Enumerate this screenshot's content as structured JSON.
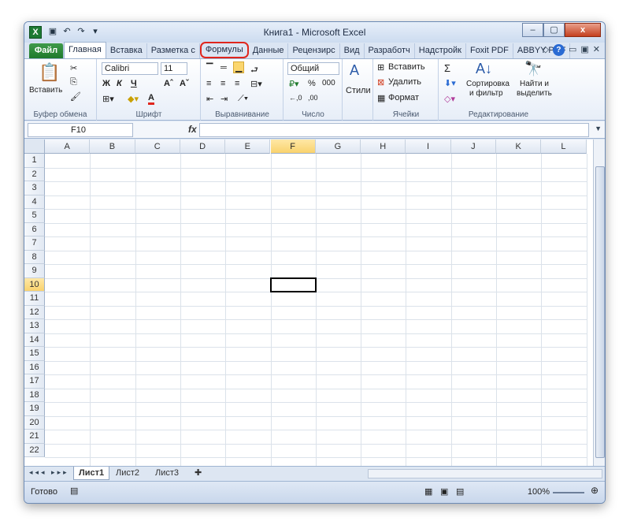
{
  "app": {
    "title": "Книга1  -  Microsoft Excel",
    "logo": "X"
  },
  "qat": {
    "save_icon": "💾",
    "undo_icon": "↶",
    "redo_icon": "↷",
    "customize_icon": "▾"
  },
  "window_buttons": {
    "minimize": "–",
    "maximize": "▢",
    "close": "x"
  },
  "tabs": [
    "Файл",
    "Главная",
    "Вставка",
    "Разметка с",
    "Формулы",
    "Данные",
    "Рецензирс",
    "Вид",
    "Разработч",
    "Надстройк",
    "Foxit PDF",
    "ABBYY PDF"
  ],
  "groups": {
    "clipboard": {
      "label": "Буфер обмена",
      "paste": "Вставить"
    },
    "font": {
      "label": "Шрифт",
      "font_name": "Calibri",
      "font_size": "11",
      "bold": "Ж",
      "italic": "К",
      "underline": "Ч",
      "grow": "Aˆ",
      "shrink": "Aˇ"
    },
    "alignment": {
      "label": "Выравнивание"
    },
    "number": {
      "label": "Число",
      "format": "Общий",
      "percent": "%",
      "thousands": "000",
      "inc_dec": ",00"
    },
    "styles": {
      "label": "Стили"
    },
    "cells": {
      "label": "Ячейки",
      "insert": "Вставить",
      "delete": "Удалить",
      "format": "Формат"
    },
    "editing": {
      "label": "Редактирование",
      "sum": "Σ",
      "sort": "Сортировка и фильтр",
      "sort1": "Сортировка",
      "sort2": "и фильтр",
      "find1": "Найти и",
      "find2": "выделить"
    }
  },
  "formula_bar": {
    "name_box": "F10",
    "fx": "fx",
    "value": ""
  },
  "grid": {
    "columns": [
      "A",
      "B",
      "C",
      "D",
      "E",
      "F",
      "G",
      "H",
      "I",
      "J",
      "K",
      "L"
    ],
    "rows": [
      "1",
      "2",
      "3",
      "4",
      "5",
      "6",
      "7",
      "8",
      "9",
      "10",
      "11",
      "12",
      "13",
      "14",
      "15",
      "16",
      "17",
      "18",
      "19",
      "20",
      "21",
      "22"
    ],
    "selected_cell": "F10"
  },
  "sheets": {
    "tabs": [
      "Лист1",
      "Лист2",
      "Лист3"
    ],
    "active": "Лист1"
  },
  "status": {
    "ready": "Готово",
    "zoom": "100%"
  },
  "colors": {
    "file_tab": "#2d8a3a",
    "highlight": "#e0261d",
    "selection": "#f9d26d"
  }
}
